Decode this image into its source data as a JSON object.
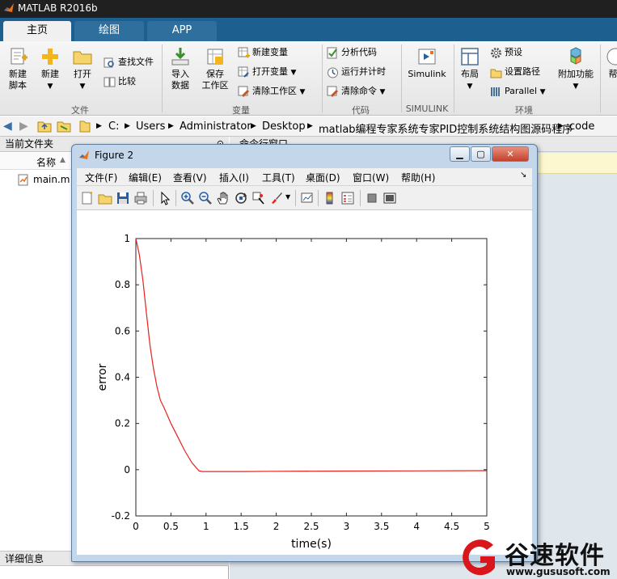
{
  "app": {
    "title": "MATLAB R2016b"
  },
  "tabs": [
    "主页",
    "绘图",
    "APP"
  ],
  "ribbon": {
    "file_group": {
      "label": "文件",
      "new_script": "新建\n脚本",
      "new": "新建",
      "open": "打开",
      "find_files": "查找文件",
      "compare": "比较"
    },
    "var_group": {
      "label": "变量",
      "import_data": "导入\n数据",
      "save_ws": "保存\n工作区",
      "new_var": "新建变量",
      "open_var": "打开变量",
      "clear_ws": "清除工作区"
    },
    "code_group": {
      "label": "代码",
      "analyze": "分析代码",
      "run_time": "运行并计时",
      "clear_cmd": "清除命令"
    },
    "simulink_group": {
      "label": "SIMULINK",
      "simulink": "Simulink"
    },
    "env_group": {
      "label": "环境",
      "layout": "布局",
      "prefs": "预设",
      "set_path": "设置路径",
      "parallel": "Parallel",
      "addons": "附加功能",
      "help": "帮"
    }
  },
  "address": {
    "crumbs": [
      "C:",
      "Users",
      "Administrator",
      "Desktop",
      "matlab编程专家系统专家PID控制系统结构图源码程序",
      "code"
    ]
  },
  "left_panel": {
    "title": "当前文件夹",
    "col_name": "名称",
    "sort_arrow": "▲",
    "files": [
      "main.m"
    ],
    "details": "详细信息"
  },
  "cmd_window": {
    "title": "命令行窗口"
  },
  "figure": {
    "title": "Figure 2",
    "menus": [
      "文件(F)",
      "编辑(E)",
      "查看(V)",
      "插入(I)",
      "工具(T)",
      "桌面(D)",
      "窗口(W)",
      "帮助(H)"
    ],
    "corner_arrow": "↘"
  },
  "chart_data": {
    "type": "line",
    "title": "",
    "xlabel": "time(s)",
    "ylabel": "error",
    "xlim": [
      0,
      5
    ],
    "ylim": [
      -0.2,
      1
    ],
    "xticks": [
      0,
      0.5,
      1,
      1.5,
      2,
      2.5,
      3,
      3.5,
      4,
      4.5,
      5
    ],
    "xtick_labels": [
      "0",
      "0.5",
      "1",
      "1.5",
      "2",
      "2.5",
      "3",
      "3.5",
      "4",
      "4.5",
      "5"
    ],
    "yticks": [
      -0.2,
      0,
      0.2,
      0.4,
      0.6,
      0.8,
      1
    ],
    "ytick_labels": [
      "-0.2",
      "0",
      "0.2",
      "0.4",
      "0.6",
      "0.8",
      "1"
    ],
    "grid": false,
    "series": [
      {
        "color": "#e8211d",
        "x": [
          0,
          0.05,
          0.1,
          0.15,
          0.2,
          0.25,
          0.3,
          0.35,
          0.4,
          0.5,
          0.6,
          0.7,
          0.8,
          0.9,
          0.95,
          1.5,
          2,
          3,
          4,
          5
        ],
        "y": [
          1,
          0.93,
          0.82,
          0.68,
          0.54,
          0.44,
          0.36,
          0.3,
          0.27,
          0.2,
          0.14,
          0.08,
          0.03,
          -0.005,
          -0.008,
          -0.008,
          -0.007,
          -0.006,
          -0.005,
          -0.004
        ]
      }
    ]
  },
  "watermark": {
    "brand": "谷速软件",
    "url": "www.gususoft.com"
  }
}
